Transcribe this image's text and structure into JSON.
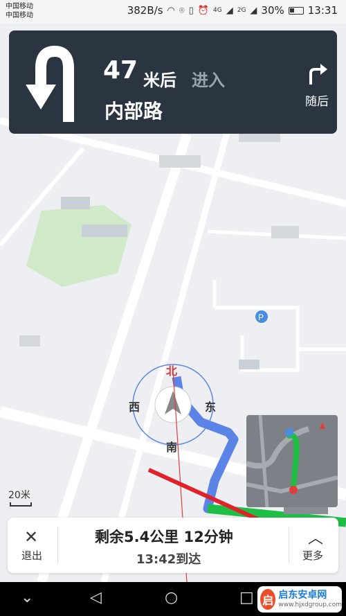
{
  "status_bar": {
    "carrier_1": "中国移动",
    "carrier_2": "中国移动",
    "net_speed": "382B/s",
    "signal_1": "4G",
    "signal_2": "2G",
    "battery": "30%",
    "time": "13:31"
  },
  "guidance": {
    "distance": "47",
    "distance_unit": "米后",
    "action": "进入",
    "road_name": "内部路",
    "next_label": "随后",
    "turn_icon": "u-turn-icon",
    "next_icon": "turn-right-icon"
  },
  "compass": {
    "north": "北",
    "east": "东",
    "south": "南",
    "west": "西"
  },
  "map": {
    "scale_label": "20米",
    "route_color": "#5c84e6",
    "traffic_color": "#1fbf45"
  },
  "bottom_panel": {
    "exit_label": "退出",
    "remaining": "剩余5.4公里 12分钟",
    "arrival": "13:42到达",
    "more_label": "更多"
  },
  "watermark": {
    "name": "启东安卓网",
    "url": "www.hjxdgroup.com"
  }
}
